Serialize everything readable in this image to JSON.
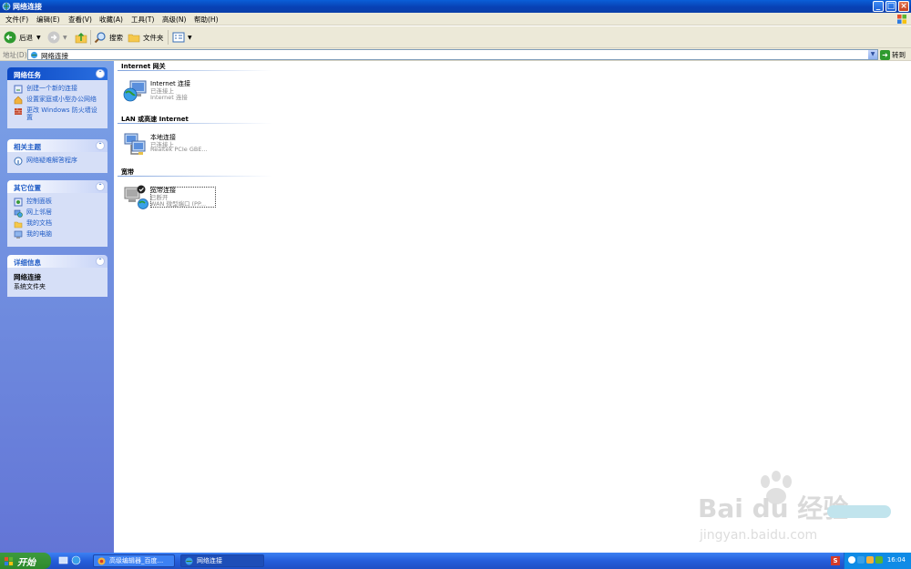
{
  "window": {
    "title": "网络连接"
  },
  "menu": [
    "文件(F)",
    "编辑(E)",
    "查看(V)",
    "收藏(A)",
    "工具(T)",
    "高级(N)",
    "帮助(H)"
  ],
  "toolbar": {
    "back": "后退",
    "search": "搜索",
    "folders": "文件夹"
  },
  "address": {
    "label": "地址(D)",
    "value": "网络连接",
    "go": "转到"
  },
  "tasks": {
    "network_tasks": {
      "title": "网络任务",
      "items": [
        "创建一个新的连接",
        "设置家庭或小型办公网络",
        "更改 Windows 防火墙设置"
      ]
    },
    "related": {
      "title": "相关主题",
      "items": [
        "网络疑难解答程序"
      ]
    },
    "other_places": {
      "title": "其它位置",
      "items": [
        "控制面板",
        "网上邻居",
        "我的文档",
        "我的电脑"
      ]
    },
    "details": {
      "title": "详细信息",
      "name": "网络连接",
      "type": "系统文件夹"
    }
  },
  "groups": [
    {
      "title": "Internet 网关",
      "connections": [
        {
          "name": "Internet 连接",
          "status": "已连接上",
          "device": "Internet 连接",
          "icon": "internet-gateway-icon"
        }
      ]
    },
    {
      "title": "LAN 或高速 Internet",
      "connections": [
        {
          "name": "本地连接",
          "status": "已连接上",
          "device": "Realtek PCIe GBE...",
          "icon": "lan-icon"
        }
      ]
    },
    {
      "title": "宽带",
      "connections": [
        {
          "name": "宽带连接",
          "status": "已断开",
          "device": "WAN 微型端口 (PP...",
          "icon": "broadband-icon"
        }
      ]
    }
  ],
  "watermark": {
    "text": "Bai du 经验",
    "sub": "jingyan.baidu.com"
  },
  "taskbar": {
    "start": "开始",
    "tasks": [
      "高级编辑器_百度...",
      "网络连接"
    ],
    "clock": "16:04"
  }
}
